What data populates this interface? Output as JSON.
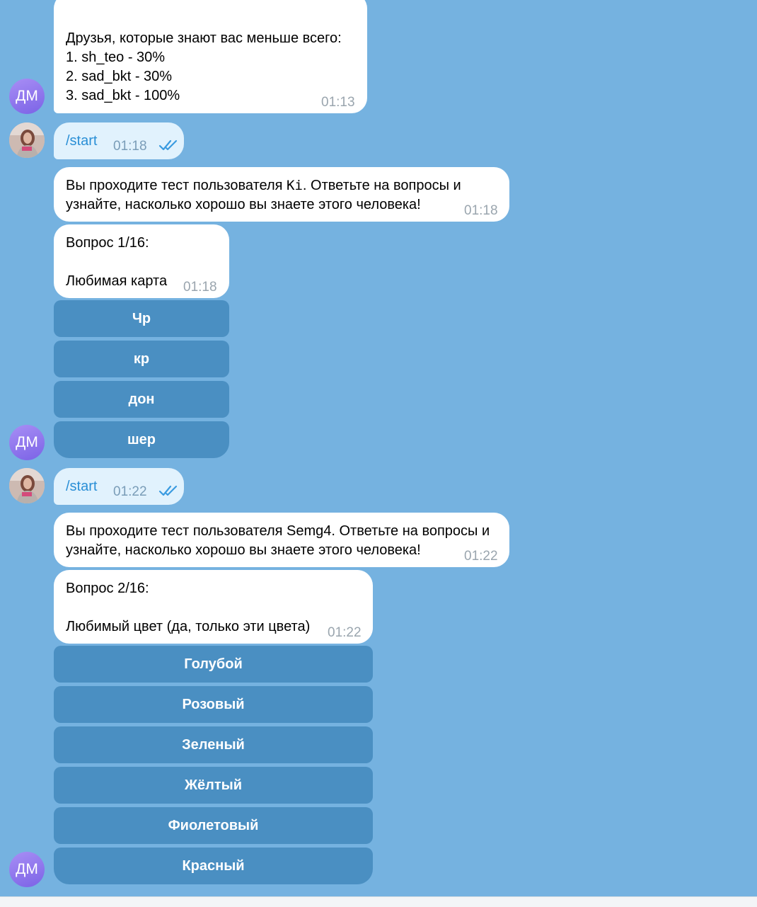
{
  "contacts": {
    "bot_initials": "ДМ"
  },
  "messages": {
    "m1": {
      "lines": [
        "Друзья, которые знают вас меньше всего:",
        "1. sh_teo - 30%",
        "2. sad_bkt - 30%",
        "3. sad_bkt - 100%"
      ],
      "time": "01:13"
    },
    "m2": {
      "text": "/start",
      "time": "01:18",
      "status": "read"
    },
    "m3": {
      "line1_pre": "Вы проходите тест пользователя ",
      "line1_user": "Ki",
      "line1_post": ". Ответьте на вопросы и",
      "line2": "узнайте, насколько хорошо вы знаете этого человека!",
      "time": "01:18"
    },
    "m4": {
      "question": "Вопрос 1/16:",
      "body": "Любимая карта",
      "time": "01:18",
      "options": [
        "Чр",
        "кр",
        "дон",
        "шер"
      ]
    },
    "m5": {
      "text": "/start",
      "time": "01:22",
      "status": "read"
    },
    "m6": {
      "line1": "Вы проходите тест пользователя Semg4. Ответьте на вопросы и",
      "line2": "узнайте, насколько хорошо вы знаете этого человека!",
      "time": "01:22"
    },
    "m7": {
      "question": "Вопрос 2/16:",
      "body": "Любимый цвет (да, только эти цвета)",
      "time": "01:22",
      "options": [
        "Голубой",
        "Розовый",
        "Зеленый",
        "Жёлтый",
        "Фиолетовый",
        "Красный"
      ]
    }
  },
  "colors": {
    "chat_background": "#75b2e0",
    "incoming_bubble": "#ffffff",
    "outgoing_bubble": "#e1f2fd",
    "keyboard_button": "#4a8fc2",
    "command_link": "#2a8fd6",
    "avatar_gradient": [
      "#a88ef5",
      "#7b63e6"
    ]
  }
}
